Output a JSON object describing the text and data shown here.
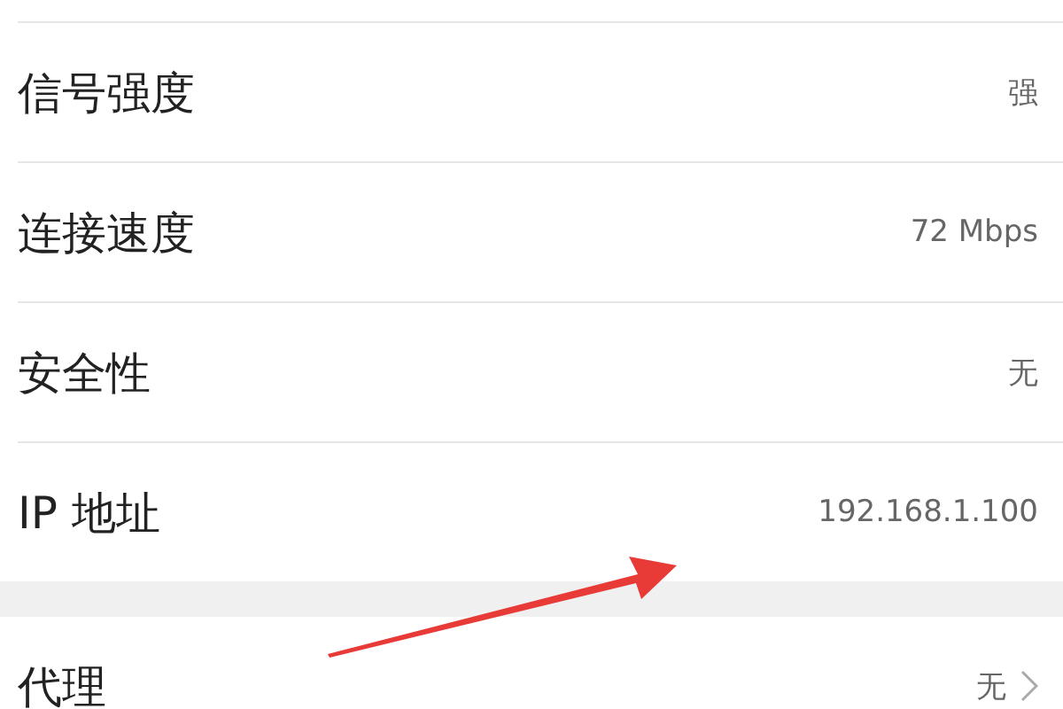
{
  "sections": [
    {
      "rows": [
        {
          "kind": "info",
          "label": "信号强度",
          "value": "强"
        },
        {
          "kind": "info",
          "label": "连接速度",
          "value": "72 Mbps"
        },
        {
          "kind": "info",
          "label": "安全性",
          "value": "无"
        },
        {
          "kind": "info",
          "label": "IP 地址",
          "value": "192.168.1.100"
        }
      ]
    },
    {
      "rows": [
        {
          "kind": "link",
          "label": "代理",
          "value": "无"
        }
      ]
    }
  ]
}
